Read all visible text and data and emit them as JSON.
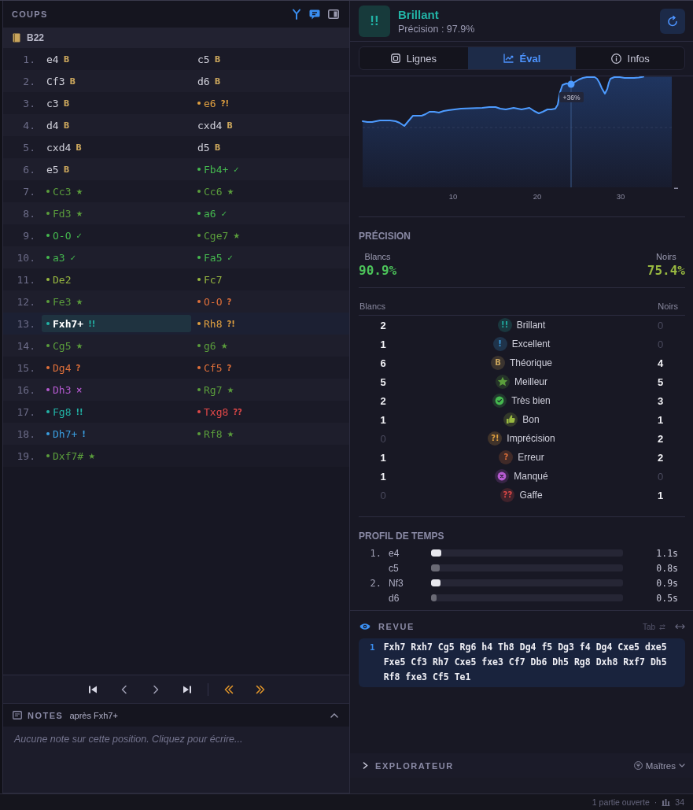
{
  "moves_panel": {
    "title": "COUPS",
    "tools": [
      {
        "kind": "branch",
        "on": true
      },
      {
        "kind": "comment",
        "on": true
      },
      {
        "kind": "panel",
        "on": false
      }
    ],
    "opening": "B22",
    "rows": [
      {
        "number": "1.",
        "white": {
          "san": "e4",
          "glyph": "B",
          "kind": "book",
          "selected": false
        },
        "black": {
          "san": "c5",
          "glyph": "B",
          "kind": "book",
          "selected": false
        }
      },
      {
        "number": "2.",
        "white": {
          "san": "Cf3",
          "glyph": "B",
          "kind": "book",
          "selected": false
        },
        "black": {
          "san": "d6",
          "glyph": "B",
          "kind": "book",
          "selected": false
        }
      },
      {
        "number": "3.",
        "white": {
          "san": "c3",
          "glyph": "B",
          "kind": "book",
          "selected": false
        },
        "black": {
          "san": "e6",
          "glyph": "?!",
          "kind": "rated",
          "color": "#e0a040",
          "selected": false
        }
      },
      {
        "number": "4.",
        "white": {
          "san": "d4",
          "glyph": "B",
          "kind": "book",
          "selected": false
        },
        "black": {
          "san": "cxd4",
          "glyph": "B",
          "kind": "book",
          "selected": false
        }
      },
      {
        "number": "5.",
        "white": {
          "san": "cxd4",
          "glyph": "B",
          "kind": "book",
          "selected": false
        },
        "black": {
          "san": "d5",
          "glyph": "B",
          "kind": "book",
          "selected": false
        }
      },
      {
        "number": "6.",
        "white": {
          "san": "e5",
          "glyph": "B",
          "kind": "book",
          "selected": false
        },
        "black": {
          "san": "Fb4+",
          "glyph": "✓",
          "kind": "rated",
          "color": "#45b94f",
          "selected": false
        }
      },
      {
        "number": "7.",
        "white": {
          "san": "Cc3",
          "glyph": "★",
          "kind": "rated",
          "color": "#5b9e3c",
          "selected": false
        },
        "black": {
          "san": "Cc6",
          "glyph": "★",
          "kind": "rated",
          "color": "#5b9e3c",
          "selected": false
        }
      },
      {
        "number": "8.",
        "white": {
          "san": "Fd3",
          "glyph": "★",
          "kind": "rated",
          "color": "#5b9e3c",
          "selected": false
        },
        "black": {
          "san": "a6",
          "glyph": "✓",
          "kind": "rated",
          "color": "#45b94f",
          "selected": false
        }
      },
      {
        "number": "9.",
        "white": {
          "san": "O-O",
          "glyph": "✓",
          "kind": "rated",
          "color": "#45b94f",
          "selected": false
        },
        "black": {
          "san": "Cge7",
          "glyph": "★",
          "kind": "rated",
          "color": "#5b9e3c",
          "selected": false
        }
      },
      {
        "number": "10.",
        "white": {
          "san": "a3",
          "glyph": "✓",
          "kind": "rated",
          "color": "#45b94f",
          "selected": false
        },
        "black": {
          "san": "Fa5",
          "glyph": "✓",
          "kind": "rated",
          "color": "#45b94f",
          "selected": false
        }
      },
      {
        "number": "11.",
        "white": {
          "san": "De2",
          "kind": "rated",
          "color": "#98b840",
          "selected": false
        },
        "black": {
          "san": "Fc7",
          "kind": "rated",
          "color": "#98b840",
          "selected": false
        }
      },
      {
        "number": "12.",
        "white": {
          "san": "Fe3",
          "glyph": "★",
          "kind": "rated",
          "color": "#5b9e3c",
          "selected": false
        },
        "black": {
          "san": "O-O",
          "glyph": "?",
          "kind": "rated",
          "color": "#e0703a",
          "selected": false
        }
      },
      {
        "number": "13.",
        "white": {
          "san": "Fxh7+",
          "glyph": "!!",
          "kind": "rated",
          "color": "#22b3a6",
          "selected": true
        },
        "black": {
          "san": "Rh8",
          "glyph": "?!",
          "kind": "rated",
          "color": "#e0a040",
          "selected": false
        }
      },
      {
        "number": "14.",
        "white": {
          "san": "Cg5",
          "glyph": "★",
          "kind": "rated",
          "color": "#5b9e3c",
          "selected": false
        },
        "black": {
          "san": "g6",
          "glyph": "★",
          "kind": "rated",
          "color": "#5b9e3c",
          "selected": false
        }
      },
      {
        "number": "15.",
        "white": {
          "san": "Dg4",
          "glyph": "?",
          "kind": "rated",
          "color": "#e0703a",
          "selected": false
        },
        "black": {
          "san": "Cf5",
          "glyph": "?",
          "kind": "rated",
          "color": "#e0703a",
          "selected": false
        }
      },
      {
        "number": "16.",
        "white": {
          "san": "Dh3",
          "glyph": "×",
          "kind": "rated",
          "color": "#b55ad0",
          "selected": false
        },
        "black": {
          "san": "Rg7",
          "glyph": "★",
          "kind": "rated",
          "color": "#5b9e3c",
          "selected": false
        }
      },
      {
        "number": "17.",
        "white": {
          "san": "Fg8",
          "glyph": "!!",
          "kind": "rated",
          "color": "#22b3a6",
          "selected": false
        },
        "black": {
          "san": "Txg8",
          "glyph": "??",
          "kind": "rated",
          "color": "#e04848",
          "selected": false
        }
      },
      {
        "number": "18.",
        "white": {
          "san": "Dh7+",
          "glyph": "!",
          "kind": "rated",
          "color": "#3a9ee0",
          "selected": false
        },
        "black": {
          "san": "Rf8",
          "glyph": "★",
          "kind": "rated",
          "color": "#5b9e3c",
          "selected": false
        }
      },
      {
        "number": "19.",
        "white": {
          "san": "Dxf7#",
          "glyph": "★",
          "kind": "rated",
          "color": "#5b9e3c",
          "selected": false
        }
      }
    ]
  },
  "notes": {
    "title": "NOTES",
    "context": "après Fxh7+",
    "expanded": true,
    "placeholder": "Aucune note sur cette position. Cliquez pour écrire..."
  },
  "move_review": {
    "badge": "!!",
    "title": "Brillant",
    "subtitle": "Précision : 97.9%"
  },
  "tabs": [
    {
      "label": "Lignes",
      "kind": "lines",
      "selected": false
    },
    {
      "label": "Éval",
      "kind": "eval",
      "selected": true
    },
    {
      "label": "Infos",
      "kind": "info",
      "selected": false
    }
  ],
  "eval_chart": {
    "x_labels": [
      "10",
      "20",
      "30"
    ],
    "marker_label": "+36%"
  },
  "accuracy": {
    "title": "PRÉCISION",
    "players": [
      {
        "label": "Blancs",
        "value": "90.9%",
        "color": "#4cc35a"
      },
      {
        "label": "Noirs",
        "value": "75.4%",
        "color": "#98b840"
      }
    ]
  },
  "classification": {
    "white_header": "Blancs",
    "black_header": "Noirs",
    "rows": [
      {
        "label": "Brillant",
        "kind": "glyph",
        "badge": "!!",
        "color": "#22b3a6",
        "white": {
          "count": "2",
          "dim": false
        },
        "black": {
          "count": "0",
          "dim": true
        }
      },
      {
        "label": "Excellent",
        "kind": "glyph",
        "badge": "!",
        "color": "#3a9ee0",
        "white": {
          "count": "1",
          "dim": false
        },
        "black": {
          "count": "0",
          "dim": true
        }
      },
      {
        "label": "Théorique",
        "kind": "glyph",
        "badge": "B",
        "color": "#c9a55c",
        "white": {
          "count": "6",
          "dim": false
        },
        "black": {
          "count": "4",
          "dim": false
        }
      },
      {
        "label": "Meilleur",
        "kind": "star",
        "color": "#5b9e3c",
        "white": {
          "count": "5",
          "dim": false
        },
        "black": {
          "count": "5",
          "dim": false
        }
      },
      {
        "label": "Très bien",
        "kind": "check",
        "color": "#45b94f",
        "white": {
          "count": "2",
          "dim": false
        },
        "black": {
          "count": "3",
          "dim": false
        }
      },
      {
        "label": "Bon",
        "kind": "thumb",
        "color": "#98b840",
        "white": {
          "count": "1",
          "dim": false
        },
        "black": {
          "count": "1",
          "dim": false
        }
      },
      {
        "label": "Imprécision",
        "kind": "glyph",
        "badge": "?!",
        "color": "#e0a040",
        "white": {
          "count": "0",
          "dim": true
        },
        "black": {
          "count": "2",
          "dim": false
        }
      },
      {
        "label": "Erreur",
        "kind": "glyph",
        "badge": "?",
        "color": "#e0703a",
        "white": {
          "count": "1",
          "dim": false
        },
        "black": {
          "count": "2",
          "dim": false
        }
      },
      {
        "label": "Manqué",
        "kind": "cross",
        "color": "#b55ad0",
        "white": {
          "count": "1",
          "dim": false
        },
        "black": {
          "count": "0",
          "dim": true
        }
      },
      {
        "label": "Gaffe",
        "kind": "glyph",
        "badge": "??",
        "color": "#e04848",
        "white": {
          "count": "0",
          "dim": true
        },
        "black": {
          "count": "1",
          "dim": false
        }
      }
    ]
  },
  "time_profile": {
    "title": "PROFIL DE TEMPS",
    "rows": [
      {
        "number": "1.",
        "move": "e4",
        "kind": "white",
        "level": 0.055,
        "time": "1.1s"
      },
      {
        "move": "c5",
        "kind": "black",
        "level": 0.045,
        "time": "0.8s"
      },
      {
        "number": "2.",
        "move": "Nf3",
        "kind": "white",
        "level": 0.05,
        "time": "0.9s"
      },
      {
        "move": "d6",
        "kind": "black",
        "level": 0.03,
        "time": "0.5s"
      }
    ]
  },
  "review": {
    "title": "REVUE",
    "hint": "Tab",
    "lines": [
      {
        "number": "1",
        "moves": "Fxh7 Rxh7 Cg5 Rg6 h4 Th8 Dg4 f5 Dg3 f4 Dg4 Cxe5 dxe5 Fxe5 Cf3 Rh7 Cxe5 fxe3 Cf7 Db6 Dh5 Rg8 Dxh8 Rxf7 Dh5 Rf8 fxe3 Cf5 Te1"
      }
    ]
  },
  "explorer": {
    "title": "EXPLORATEUR",
    "expanded": false,
    "source": "Maîtres"
  },
  "status_bar": {
    "text": "1 partie ouverte",
    "separator": "·",
    "count": "34"
  }
}
